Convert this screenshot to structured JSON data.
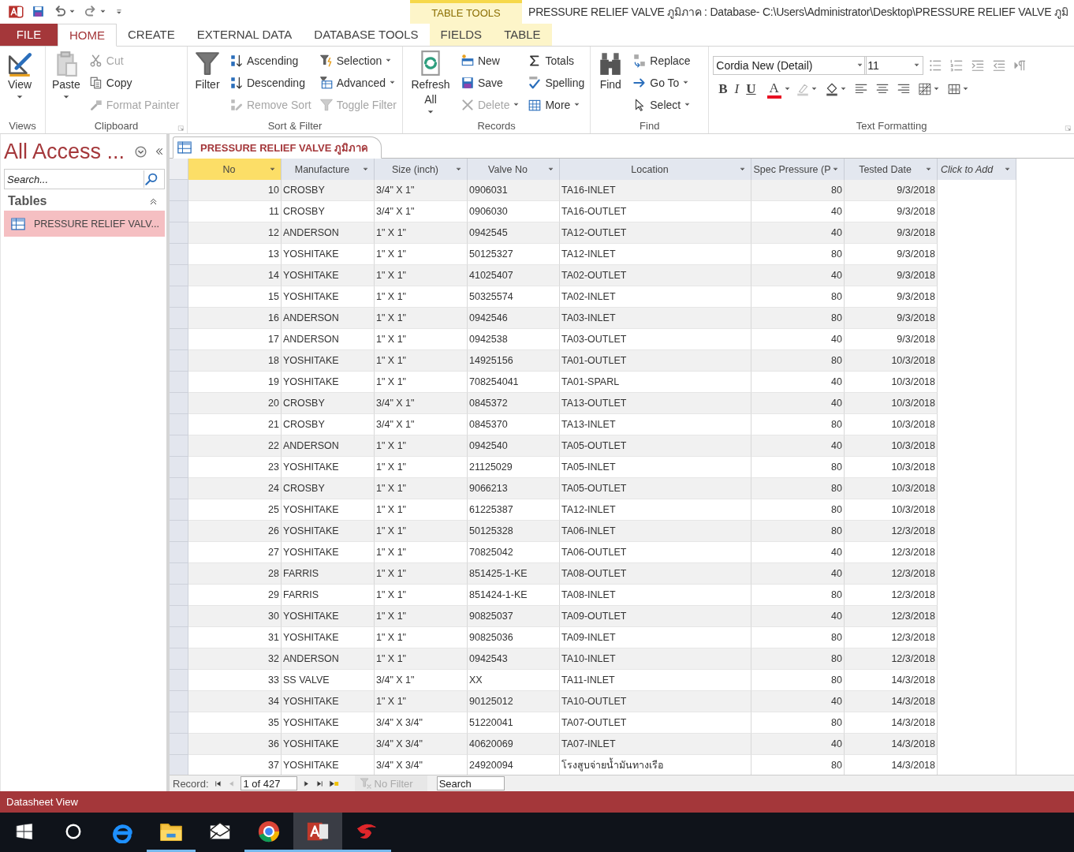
{
  "window": {
    "title": "PRESSURE RELIEF VALVE ภูมิภาค : Database- C:\\Users\\Administrator\\Desktop\\PRESSURE RELIEF VALVE ภูมิ",
    "context_label": "TABLE TOOLS"
  },
  "tabs": [
    {
      "label": "FILE",
      "kind": "file",
      "selected": false
    },
    {
      "label": "HOME",
      "kind": "normal",
      "selected": true
    },
    {
      "label": "CREATE",
      "kind": "normal",
      "selected": false
    },
    {
      "label": "EXTERNAL DATA",
      "kind": "normal",
      "selected": false
    },
    {
      "label": "DATABASE TOOLS",
      "kind": "normal",
      "selected": false
    },
    {
      "label": "FIELDS",
      "kind": "context",
      "selected": false
    },
    {
      "label": "TABLE",
      "kind": "context",
      "selected": false
    }
  ],
  "ribbon": [
    {
      "label": "Views",
      "kind": "buttons",
      "launcher": false,
      "large": [
        {
          "label": "View",
          "dropdown": true,
          "disabled": false
        }
      ]
    },
    {
      "label": "Clipboard",
      "kind": "buttons",
      "launcher": true,
      "large": [
        {
          "label": "Paste",
          "dropdown": true,
          "disabled": false
        }
      ],
      "columns": [
        [
          {
            "label": "Cut",
            "dropdown": false,
            "disabled": true
          },
          {
            "label": "Copy",
            "dropdown": false,
            "disabled": false
          },
          {
            "label": "Format Painter",
            "dropdown": false,
            "disabled": true
          }
        ]
      ]
    },
    {
      "label": "Sort & Filter",
      "kind": "buttons",
      "launcher": false,
      "large": [
        {
          "label": "Filter",
          "dropdown": false,
          "disabled": false
        }
      ],
      "columns": [
        [
          {
            "label": "Ascending",
            "dropdown": false,
            "disabled": false
          },
          {
            "label": "Descending",
            "dropdown": false,
            "disabled": false
          },
          {
            "label": "Remove Sort",
            "dropdown": false,
            "disabled": true
          }
        ],
        [
          {
            "label": "Selection",
            "dropdown": true,
            "disabled": false
          },
          {
            "label": "Advanced",
            "dropdown": true,
            "disabled": false
          },
          {
            "label": "Toggle Filter",
            "dropdown": false,
            "disabled": true
          }
        ]
      ]
    },
    {
      "label": "Records",
      "kind": "buttons",
      "launcher": false,
      "large": [
        {
          "label": "Refresh All",
          "dropdown": true,
          "disabled": false
        }
      ],
      "columns": [
        [
          {
            "label": "New",
            "dropdown": false,
            "disabled": false
          },
          {
            "label": "Save",
            "dropdown": false,
            "disabled": false
          },
          {
            "label": "Delete",
            "dropdown": true,
            "disabled": true
          }
        ],
        [
          {
            "label": "Totals",
            "dropdown": false,
            "disabled": false
          },
          {
            "label": "Spelling",
            "dropdown": false,
            "disabled": false
          },
          {
            "label": "More",
            "dropdown": true,
            "disabled": false
          }
        ]
      ]
    },
    {
      "label": "Find",
      "kind": "buttons",
      "launcher": false,
      "large": [
        {
          "label": "Find",
          "dropdown": false,
          "disabled": false
        }
      ],
      "columns": [
        [
          {
            "label": "Replace",
            "dropdown": false,
            "disabled": false
          },
          {
            "label": "Go To",
            "dropdown": true,
            "disabled": false
          },
          {
            "label": "Select",
            "dropdown": true,
            "disabled": false
          }
        ]
      ]
    },
    {
      "label": "Text Formatting",
      "kind": "format",
      "launcher": true,
      "font": "Cordia New (Detail)",
      "size": "11",
      "styles": [
        "B",
        "I",
        "U",
        "A"
      ]
    }
  ],
  "nav": {
    "title": "All Access ...",
    "search": {
      "placeholder": "Search..."
    },
    "section": "Tables",
    "items": [
      {
        "label": "PRESSURE RELIEF VALV...",
        "selected": true
      }
    ]
  },
  "document_tab": "PRESSURE RELIEF VALVE ภูมิภาค",
  "table": {
    "columns": [
      {
        "label": "No",
        "kind": "number",
        "selected": true
      },
      {
        "label": "Manufacture",
        "kind": "text",
        "selected": false
      },
      {
        "label": "Size (inch)",
        "kind": "text",
        "selected": false
      },
      {
        "label": "Valve No",
        "kind": "text",
        "selected": false
      },
      {
        "label": "Location",
        "kind": "text",
        "selected": false
      },
      {
        "label": "Spec Pressure (P",
        "kind": "number",
        "selected": false
      },
      {
        "label": "Tested Date",
        "kind": "number",
        "selected": false
      },
      {
        "label": "Click to Add",
        "kind": "add",
        "selected": false
      }
    ],
    "rows": [
      [
        "10",
        "CROSBY",
        "3/4\" X 1\"",
        "0906031",
        "TA16-INLET",
        "80",
        "9/3/2018"
      ],
      [
        "11",
        "CROSBY",
        "3/4\" X 1\"",
        "0906030",
        "TA16-OUTLET",
        "40",
        "9/3/2018"
      ],
      [
        "12",
        "ANDERSON",
        "1\" X 1\"",
        "0942545",
        "TA12-OUTLET",
        "40",
        "9/3/2018"
      ],
      [
        "13",
        "YOSHITAKE",
        "1\" X 1\"",
        "50125327",
        "TA12-INLET",
        "80",
        "9/3/2018"
      ],
      [
        "14",
        "YOSHITAKE",
        "1\" X 1\"",
        "41025407",
        "TA02-OUTLET",
        "40",
        "9/3/2018"
      ],
      [
        "15",
        "YOSHITAKE",
        "1\" X 1\"",
        "50325574",
        "TA02-INLET",
        "80",
        "9/3/2018"
      ],
      [
        "16",
        "ANDERSON",
        "1\" X 1\"",
        "0942546",
        "TA03-INLET",
        "80",
        "9/3/2018"
      ],
      [
        "17",
        "ANDERSON",
        "1\" X 1\"",
        "0942538",
        "TA03-OUTLET",
        "40",
        "9/3/2018"
      ],
      [
        "18",
        "YOSHITAKE",
        "1\" X 1\"",
        "14925156",
        "TA01-OUTLET",
        "80",
        "10/3/2018"
      ],
      [
        "19",
        "YOSHITAKE",
        "1\" X 1\"",
        "708254041",
        "TA01-SPARL",
        "40",
        "10/3/2018"
      ],
      [
        "20",
        "CROSBY",
        "3/4\" X 1\"",
        "0845372",
        "TA13-OUTLET",
        "40",
        "10/3/2018"
      ],
      [
        "21",
        "CROSBY",
        "3/4\" X 1\"",
        "0845370",
        "TA13-INLET",
        "80",
        "10/3/2018"
      ],
      [
        "22",
        "ANDERSON",
        "1\" X 1\"",
        "0942540",
        "TA05-OUTLET",
        "40",
        "10/3/2018"
      ],
      [
        "23",
        "YOSHITAKE",
        "1\" X 1\"",
        "21125029",
        "TA05-INLET",
        "80",
        "10/3/2018"
      ],
      [
        "24",
        "CROSBY",
        "1\" X 1\"",
        "9066213",
        "TA05-OUTLET",
        "80",
        "10/3/2018"
      ],
      [
        "25",
        "YOSHITAKE",
        "1\" X 1\"",
        "61225387",
        "TA12-INLET",
        "80",
        "10/3/2018"
      ],
      [
        "26",
        "YOSHITAKE",
        "1\" X 1\"",
        "50125328",
        "TA06-INLET",
        "80",
        "12/3/2018"
      ],
      [
        "27",
        "YOSHITAKE",
        "1\" X 1\"",
        "70825042",
        "TA06-OUTLET",
        "40",
        "12/3/2018"
      ],
      [
        "28",
        "FARRIS",
        "1\" X 1\"",
        "851425-1-KE",
        "TA08-OUTLET",
        "40",
        "12/3/2018"
      ],
      [
        "29",
        "FARRIS",
        "1\" X 1\"",
        "851424-1-KE",
        "TA08-INLET",
        "80",
        "12/3/2018"
      ],
      [
        "30",
        "YOSHITAKE",
        "1\" X 1\"",
        "90825037",
        "TA09-OUTLET",
        "40",
        "12/3/2018"
      ],
      [
        "31",
        "YOSHITAKE",
        "1\" X 1\"",
        "90825036",
        "TA09-INLET",
        "80",
        "12/3/2018"
      ],
      [
        "32",
        "ANDERSON",
        "1\" X 1\"",
        "0942543",
        "TA10-INLET",
        "80",
        "12/3/2018"
      ],
      [
        "33",
        "SS VALVE",
        "3/4\" X 1\"",
        "XX",
        "TA11-INLET",
        "80",
        "14/3/2018"
      ],
      [
        "34",
        "YOSHITAKE",
        "1\" X 1\"",
        "90125012",
        "TA10-OUTLET",
        "40",
        "14/3/2018"
      ],
      [
        "35",
        "YOSHITAKE",
        "3/4\" X 3/4\"",
        "51220041",
        "TA07-OUTLET",
        "80",
        "14/3/2018"
      ],
      [
        "36",
        "YOSHITAKE",
        "3/4\" X 3/4\"",
        "40620069",
        "TA07-INLET",
        "40",
        "14/3/2018"
      ],
      [
        "37",
        "YOSHITAKE",
        "3/4\" X 3/4\"",
        "24920094",
        "โรงสูบจ่ายน้ำมันทางเรือ",
        "80",
        "14/3/2018"
      ]
    ]
  },
  "record_bar": {
    "label": "Record:",
    "position": "1 of 427",
    "filter": {
      "label": "No Filter",
      "disabled": true
    },
    "search": {
      "placeholder": "Search"
    }
  },
  "status_bar": "Datasheet View",
  "taskbar": [
    {
      "running": false,
      "active": false
    },
    {
      "running": false,
      "active": false
    },
    {
      "running": false,
      "active": false
    },
    {
      "running": true,
      "active": false
    },
    {
      "running": false,
      "active": false
    },
    {
      "running": true,
      "active": false
    },
    {
      "running": true,
      "active": true
    },
    {
      "running": true,
      "active": false
    }
  ]
}
